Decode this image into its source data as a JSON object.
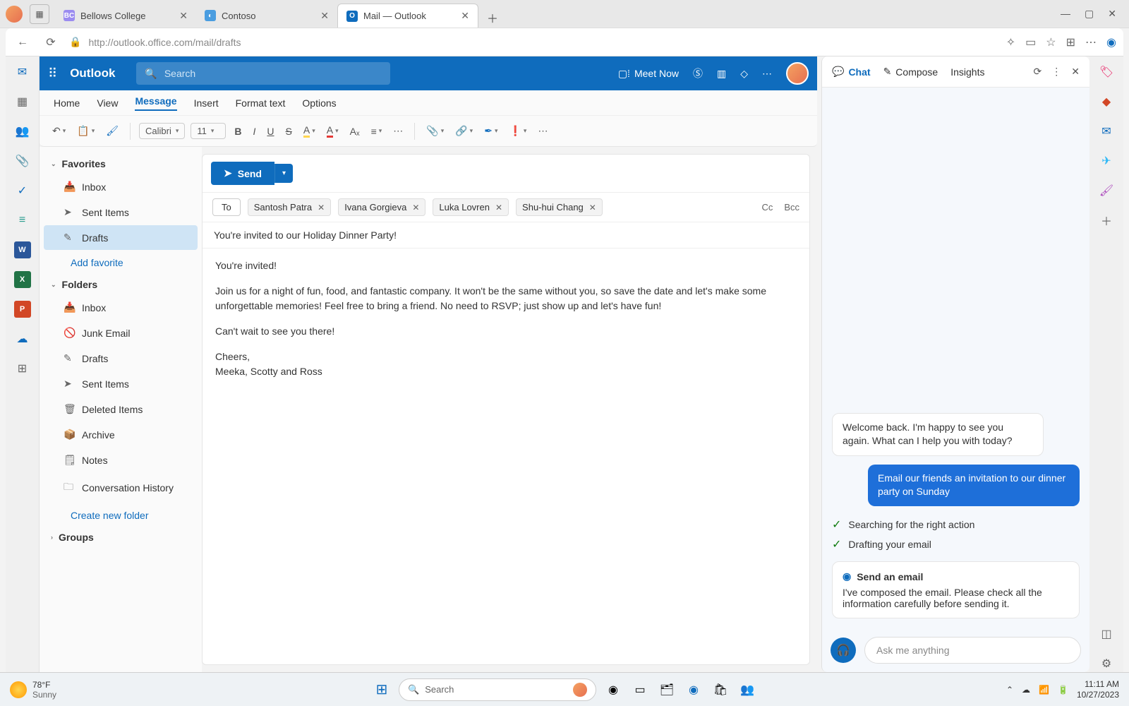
{
  "browser": {
    "tabs": [
      {
        "label": "Bellows College",
        "icon_bg": "#9b8cf0",
        "icon_text": "BC"
      },
      {
        "label": "Contoso",
        "icon_bg": "#4a9de0",
        "icon_text": "◐"
      },
      {
        "label": "Mail — Outlook",
        "icon_bg": "#0f6cbd",
        "icon_text": "O",
        "active": true
      }
    ],
    "url": "http://outlook.office.com/mail/drafts"
  },
  "outlook": {
    "app_name": "Outlook",
    "search_placeholder": "Search",
    "meet_now": "Meet Now",
    "ribbon_tabs": [
      "Home",
      "View",
      "Message",
      "Insert",
      "Format text",
      "Options"
    ],
    "ribbon_active": "Message",
    "font_name": "Calibri",
    "font_size": "11",
    "folders": {
      "favorites_label": "Favorites",
      "favorites": [
        {
          "icon": "inbox",
          "label": "Inbox"
        },
        {
          "icon": "sent",
          "label": "Sent Items"
        },
        {
          "icon": "drafts",
          "label": "Drafts",
          "selected": true
        }
      ],
      "add_favorite": "Add favorite",
      "folders_label": "Folders",
      "list": [
        {
          "icon": "inbox",
          "label": "Inbox"
        },
        {
          "icon": "junk",
          "label": "Junk Email"
        },
        {
          "icon": "drafts",
          "label": "Drafts"
        },
        {
          "icon": "sent",
          "label": "Sent Items"
        },
        {
          "icon": "deleted",
          "label": "Deleted Items"
        },
        {
          "icon": "archive",
          "label": "Archive"
        },
        {
          "icon": "notes",
          "label": "Notes"
        },
        {
          "icon": "folder",
          "label": "Conversation History"
        }
      ],
      "create_new": "Create new folder",
      "groups_label": "Groups"
    },
    "compose": {
      "send_label": "Send",
      "to_label": "To",
      "cc_label": "Cc",
      "bcc_label": "Bcc",
      "recipients": [
        "Santosh Patra",
        "Ivana Gorgieva",
        "Luka Lovren",
        "Shu-hui Chang"
      ],
      "subject": "You're invited to our Holiday Dinner Party!",
      "body_p1": "You're invited!",
      "body_p2": "Join us for a night of fun, food, and fantastic company. It won't be the same without you, so save the date and let's make some unforgettable memories! Feel free to bring a friend. No need to RSVP; just show up and let's have fun!",
      "body_p3": "Can't wait to see you there!",
      "body_p4": "Cheers,",
      "body_p5": "Meeka, Scotty and Ross"
    }
  },
  "copilot": {
    "tabs": {
      "chat": "Chat",
      "compose": "Compose",
      "insights": "Insights"
    },
    "welcome": "Welcome back. I'm happy to see you again. What can I help you with today?",
    "user_msg": "Email our friends an invitation to our dinner party on Sunday",
    "action1": "Searching for the right action",
    "action2": "Drafting your email",
    "card_title": "Send an email",
    "card_body": "I've composed the email. Please check all the information carefully before sending it.",
    "input_placeholder": "Ask me anything"
  },
  "taskbar": {
    "temp": "78°F",
    "weather": "Sunny",
    "search": "Search",
    "time": "11:11 AM",
    "date": "10/27/2023"
  }
}
